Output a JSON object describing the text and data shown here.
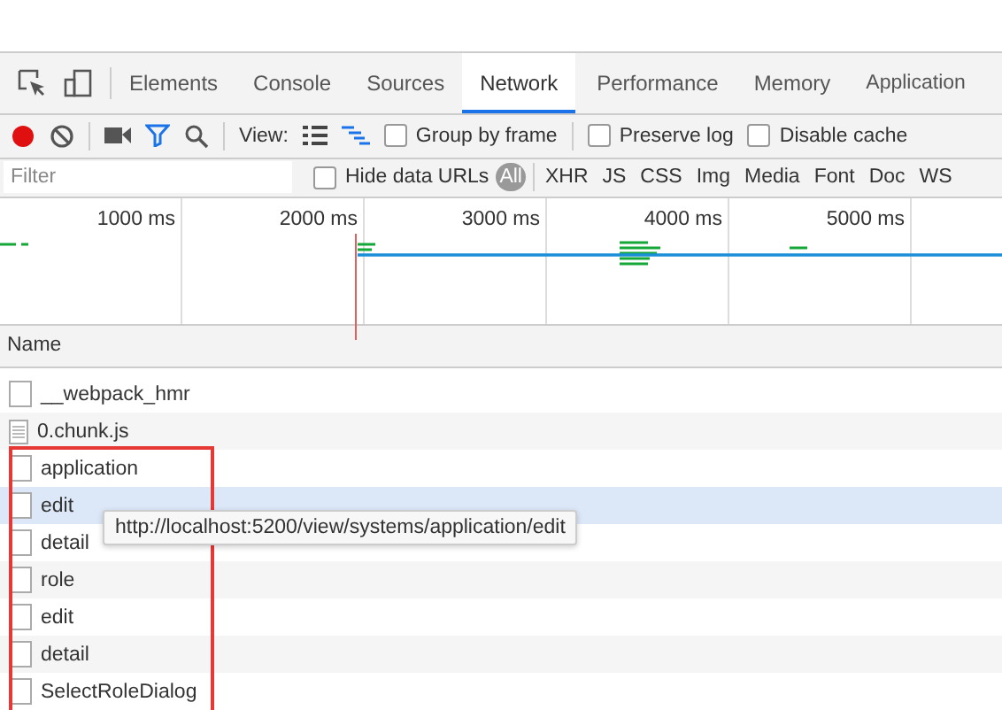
{
  "tabs": [
    {
      "label": "Elements",
      "selected": false
    },
    {
      "label": "Console",
      "selected": false
    },
    {
      "label": "Sources",
      "selected": false
    },
    {
      "label": "Network",
      "selected": true
    },
    {
      "label": "Performance",
      "selected": false
    },
    {
      "label": "Memory",
      "selected": false
    },
    {
      "label": "Application",
      "selected": false
    }
  ],
  "toolbar": {
    "recording": true,
    "view_label": "View:",
    "options": [
      {
        "label": "Group by frame",
        "checked": false
      },
      {
        "label": "Preserve log",
        "checked": false
      },
      {
        "label": "Disable cache",
        "checked": false
      }
    ]
  },
  "filter": {
    "placeholder": "Filter",
    "hide_data_urls": {
      "label": "Hide data URLs",
      "checked": false
    },
    "types": [
      {
        "label": "All",
        "selected": true
      },
      {
        "label": "XHR",
        "selected": false
      },
      {
        "label": "JS",
        "selected": false
      },
      {
        "label": "CSS",
        "selected": false
      },
      {
        "label": "Img",
        "selected": false
      },
      {
        "label": "Media",
        "selected": false
      },
      {
        "label": "Font",
        "selected": false
      },
      {
        "label": "Doc",
        "selected": false
      },
      {
        "label": "WS",
        "selected": false
      }
    ]
  },
  "timeline": {
    "ticks": [
      "1000 ms",
      "2000 ms",
      "3000 ms",
      "4000 ms",
      "5000 ms"
    ]
  },
  "table": {
    "column": "Name",
    "rows": [
      {
        "name": "__webpack_hmr",
        "kind": "blank",
        "hovered": false
      },
      {
        "name": "0.chunk.js",
        "kind": "script",
        "hovered": false
      }
    ],
    "highlighted_rows": [
      {
        "name": "application",
        "kind": "blank",
        "hovered": false
      },
      {
        "name": "edit",
        "kind": "blank",
        "hovered": true
      },
      {
        "name": "detail",
        "kind": "blank",
        "hovered": false
      },
      {
        "name": "role",
        "kind": "blank",
        "hovered": false
      },
      {
        "name": "edit",
        "kind": "blank",
        "hovered": false
      },
      {
        "name": "detail",
        "kind": "blank",
        "hovered": false
      },
      {
        "name": "SelectRoleDialog",
        "kind": "blank",
        "hovered": false
      }
    ]
  },
  "tooltip": {
    "text": "http://localhost:5200/view/systems/application/edit"
  }
}
